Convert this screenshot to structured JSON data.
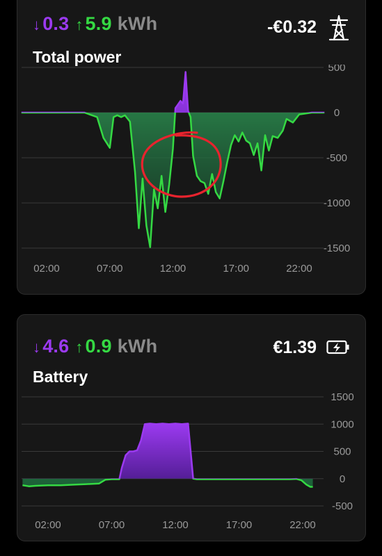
{
  "colors": {
    "import": "#9b3af0",
    "export": "#35d943",
    "unit": "#8a8a8a",
    "grid": "#3a3a3a",
    "axis_text": "#9a9a9a",
    "annotation": "#e8232e"
  },
  "cards": [
    {
      "id": "total-power",
      "title": "Total power",
      "import_value": "0.3",
      "export_value": "5.9",
      "unit": "kWh",
      "cost": "-€0.32",
      "icon": "power-tower-icon",
      "import_arrow": "↓",
      "export_arrow": "↑"
    },
    {
      "id": "battery",
      "title": "Battery",
      "import_value": "4.6",
      "export_value": "0.9",
      "unit": "kWh",
      "cost": "€1.39",
      "icon": "battery-charging-icon",
      "import_arrow": "↓",
      "export_arrow": "↑"
    }
  ],
  "chart_data": [
    {
      "type": "area",
      "title": "Total power",
      "x_tick_labels": [
        "02:00",
        "07:00",
        "12:00",
        "17:00",
        "22:00"
      ],
      "y_tick_labels": [
        "500",
        "0",
        "-500",
        "-1000",
        "-1500"
      ],
      "ylim": [
        -1500,
        500
      ],
      "grid": true,
      "annotation": "red hand-drawn circle around the midday import spike",
      "x": [
        0,
        1,
        2,
        3,
        4,
        5,
        6,
        6.5,
        7,
        7.3,
        7.6,
        7.9,
        8.2,
        8.6,
        9,
        9.3,
        9.6,
        9.9,
        10.2,
        10.5,
        10.8,
        11.1,
        11.4,
        11.7,
        12,
        12.2,
        12.4,
        12.6,
        12.8,
        13,
        13.2,
        13.4,
        13.6,
        13.9,
        14.2,
        14.5,
        14.8,
        15.1,
        15.4,
        15.7,
        16,
        16.3,
        16.6,
        16.9,
        17.2,
        17.5,
        17.8,
        18.1,
        18.4,
        18.7,
        19,
        19.3,
        19.6,
        19.9,
        20.3,
        20.7,
        21,
        21.5,
        22,
        23,
        24
      ],
      "series": [
        {
          "y": [
            0,
            0,
            0,
            0,
            0,
            0,
            -50,
            -280,
            -390,
            -50,
            -30,
            -50,
            -30,
            -100,
            -660,
            -1280,
            -730,
            -1250,
            -1490,
            -850,
            -1060,
            -700,
            -1100,
            -800,
            -400,
            50,
            90,
            130,
            100,
            450,
            20,
            -50,
            -480,
            -700,
            -760,
            -780,
            -900,
            -680,
            -880,
            -950,
            -760,
            -550,
            -360,
            -250,
            -320,
            -220,
            -310,
            -340,
            -470,
            -340,
            -640,
            -250,
            -420,
            -260,
            -280,
            -200,
            -70,
            -110,
            -20,
            0,
            0
          ]
        }
      ]
    },
    {
      "type": "area",
      "title": "Battery",
      "x_tick_labels": [
        "02:00",
        "07:00",
        "12:00",
        "17:00",
        "22:00"
      ],
      "y_tick_labels": [
        "1500",
        "1000",
        "500",
        "0",
        "-500"
      ],
      "ylim": [
        -500,
        1500
      ],
      "grid": true,
      "x": [
        0,
        0.5,
        1,
        2,
        3,
        4,
        5,
        6,
        6.5,
        7,
        7.2,
        7.4,
        7.6,
        7.8,
        8.1,
        8.4,
        8.7,
        9.0,
        9.3,
        9.6,
        10,
        10.5,
        11,
        11.5,
        12,
        12.5,
        13,
        13.2,
        13.4,
        13.7,
        14,
        15,
        16,
        17,
        18,
        19,
        20,
        21,
        21.5,
        21.9,
        22.3,
        22.6,
        22.8
      ],
      "series": [
        {
          "y": [
            -120,
            -140,
            -130,
            -120,
            -120,
            -110,
            -100,
            -90,
            -20,
            -10,
            -10,
            -10,
            -10,
            200,
            430,
            500,
            500,
            520,
            700,
            1000,
            1010,
            1000,
            1010,
            1000,
            1010,
            1000,
            1010,
            500,
            0,
            -10,
            -10,
            -10,
            -10,
            -10,
            -10,
            -10,
            -10,
            -10,
            -5,
            -30,
            -110,
            -150,
            -150
          ]
        }
      ]
    }
  ]
}
